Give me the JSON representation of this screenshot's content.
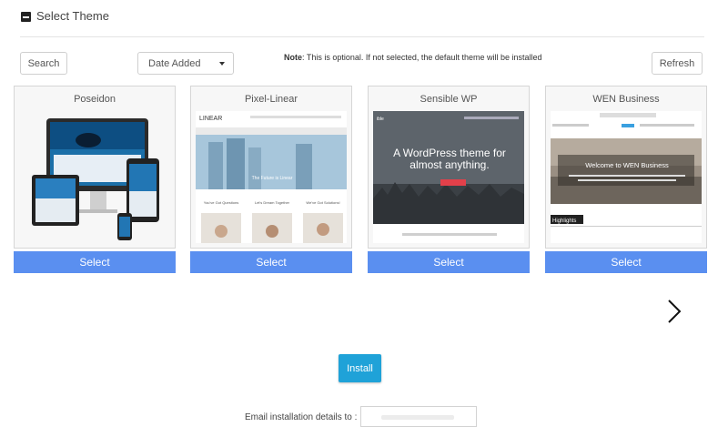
{
  "header": {
    "title": "Select Theme"
  },
  "toolbar": {
    "search_label": "Search",
    "sort_selected": "Date Added",
    "note_label": "Note",
    "note_text": ": This is optional. If not selected, the default theme will be installed",
    "refresh_label": "Refresh"
  },
  "themes": [
    {
      "name": "Poseidon",
      "select_label": "Select"
    },
    {
      "name": "Pixel-Linear",
      "select_label": "Select"
    },
    {
      "name": "Sensible WP",
      "select_label": "Select"
    },
    {
      "name": "WEN Business",
      "select_label": "Select"
    }
  ],
  "previews": {
    "pixel_linear": {
      "logo": "LINEAR",
      "hero_text": "The Future is Linear",
      "columns": [
        "You've Got Questions",
        "Let's Dream Together",
        "We've Got Solutions!"
      ]
    },
    "sensible_wp": {
      "brand": "ible",
      "headline_1": "A WordPress theme for",
      "headline_2": "almost anything."
    },
    "wen_business": {
      "hero_title": "Welcome to WEN Business",
      "highlights_label": "Highlights"
    }
  },
  "install": {
    "label": "Install"
  },
  "email": {
    "label": "Email installation details to :"
  },
  "colors": {
    "select_blue": "#5a8ff0",
    "install_blue": "#1fa2d8"
  }
}
